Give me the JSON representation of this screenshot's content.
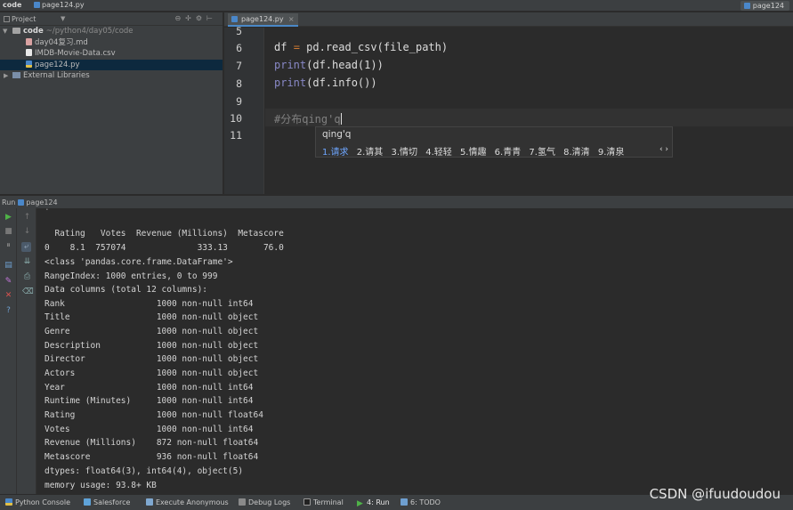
{
  "titlebar": {
    "project": "code",
    "file": "page124.py",
    "run_config": "page124"
  },
  "project_panel": {
    "title": "Project",
    "tree": [
      {
        "name": "code",
        "path": "~/python4/day05/code",
        "type": "folder",
        "expanded": true
      },
      {
        "name": "day04复习.md",
        "type": "md"
      },
      {
        "name": "IMDB-Movie-Data.csv",
        "type": "csv"
      },
      {
        "name": "page124.py",
        "type": "py",
        "selected": true
      },
      {
        "name": "External Libraries",
        "type": "libs",
        "expanded": false
      }
    ]
  },
  "editor": {
    "tab": "page124.py",
    "lines": [
      {
        "num": "5",
        "text": ""
      },
      {
        "num": "6",
        "text": "df = pd.read_csv(file_path)"
      },
      {
        "num": "7",
        "text": "print(df.head(1))"
      },
      {
        "num": "8",
        "text": "print(df.info())"
      },
      {
        "num": "9",
        "text": ""
      },
      {
        "num": "10",
        "text": "#分布qing'q"
      },
      {
        "num": "11",
        "text": ""
      }
    ]
  },
  "ime": {
    "composition": "qing'q",
    "candidates": [
      "1.请求",
      "2.请其",
      "3.情切",
      "4.轻轻",
      "5.情趣",
      "6.青青",
      "7.氢气",
      "8.清清",
      "9.清泉"
    ],
    "nav": "‹ ›"
  },
  "run_panel": {
    "label": "Run",
    "config": "page124",
    "console": [
      "  Rating   Votes  Revenue (Millions)  Metascore",
      "0    8.1  757074              333.13       76.0",
      "<class 'pandas.core.frame.DataFrame'>",
      "RangeIndex: 1000 entries, 0 to 999",
      "Data columns (total 12 columns):",
      "Rank                  1000 non-null int64",
      "Title                 1000 non-null object",
      "Genre                 1000 non-null object",
      "Description           1000 non-null object",
      "Director              1000 non-null object",
      "Actors                1000 non-null object",
      "Year                  1000 non-null int64",
      "Runtime (Minutes)     1000 non-null int64",
      "Rating                1000 non-null float64",
      "Votes                 1000 non-null int64",
      "Revenue (Millions)    872 non-null float64",
      "Metascore             936 non-null float64",
      "dtypes: float64(3), int64(4), object(5)",
      "memory usage: 93.8+ KB"
    ]
  },
  "bottom_bar": {
    "items": [
      "Python Console",
      "Salesforce",
      "Execute Anonymous",
      "Debug Logs",
      "Terminal",
      "4: Run",
      "6: TODO"
    ]
  },
  "watermark": "CSDN @ifuudoudou"
}
